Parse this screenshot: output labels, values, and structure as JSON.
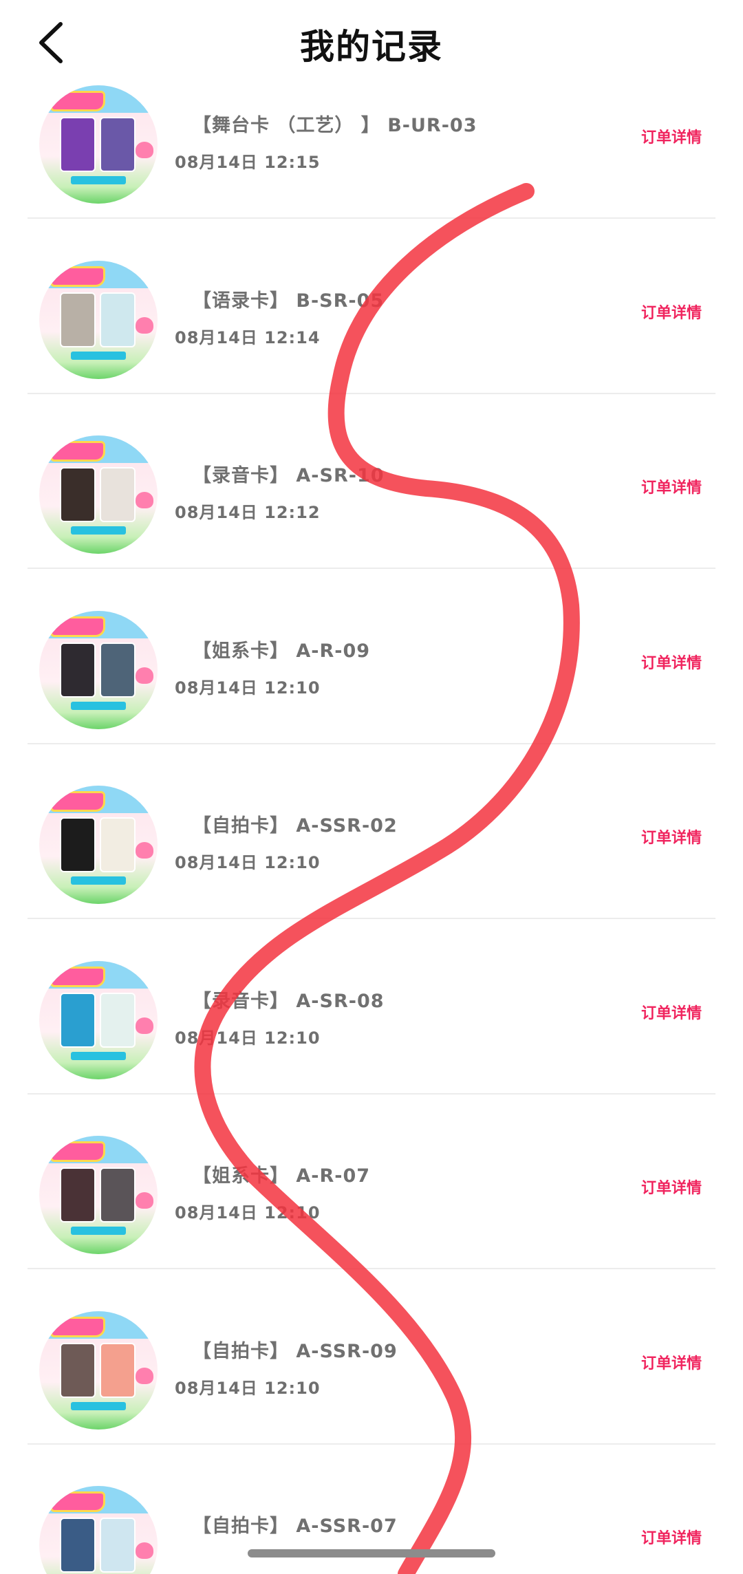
{
  "header": {
    "title": "我的记录",
    "back_icon": "chevron-left-icon"
  },
  "records": [
    {
      "title": "【舞台卡 （工艺） 】 B-UR-03",
      "time": "08月14日  12:15",
      "link": "订单详情",
      "card_a_color": "#7a3fb0",
      "card_b_color": "#6a58a8"
    },
    {
      "title": "【语录卡】 B-SR-05",
      "time": "08月14日  12:14",
      "link": "订单详情",
      "card_a_color": "#b8b0a6",
      "card_b_color": "#cfe8ee"
    },
    {
      "title": "【录音卡】 A-SR-10",
      "time": "08月14日  12:12",
      "link": "订单详情",
      "card_a_color": "#3a2e2a",
      "card_b_color": "#e8e2dc"
    },
    {
      "title": "【姐系卡】 A-R-09",
      "time": "08月14日  12:10",
      "link": "订单详情",
      "card_a_color": "#2e2a30",
      "card_b_color": "#4e6478"
    },
    {
      "title": "【自拍卡】 A-SSR-02",
      "time": "08月14日  12:10",
      "link": "订单详情",
      "card_a_color": "#1c1c1c",
      "card_b_color": "#f2ede2"
    },
    {
      "title": "【录音卡】 A-SR-08",
      "time": "08月14日  12:10",
      "link": "订单详情",
      "card_a_color": "#2a9fd0",
      "card_b_color": "#e4f1ee"
    },
    {
      "title": "【姐系卡】 A-R-07",
      "time": "08月14日  12:10",
      "link": "订单详情",
      "card_a_color": "#4a3236",
      "card_b_color": "#5a5458"
    },
    {
      "title": "【自拍卡】 A-SSR-09",
      "time": "08月14日  12:10",
      "link": "订单详情",
      "card_a_color": "#6e5a56",
      "card_b_color": "#f4a08e"
    },
    {
      "title": "【自拍卡】 A-SSR-07",
      "time": "",
      "link": "订单详情",
      "card_a_color": "#3a5c86",
      "card_b_color": "#cfe6f0"
    }
  ],
  "colors": {
    "accent": "#f0245e",
    "scribble": "#f3343f",
    "divider": "#ececec",
    "text_secondary": "#707070"
  }
}
